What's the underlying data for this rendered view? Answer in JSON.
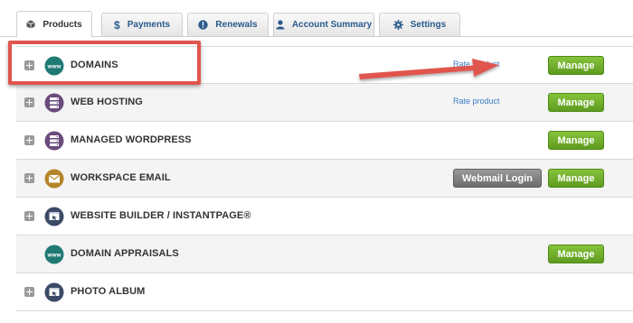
{
  "tabs": [
    {
      "label": "Products",
      "icon": "box-icon",
      "active": true
    },
    {
      "label": "Payments",
      "icon": "dollar-icon",
      "active": false
    },
    {
      "label": "Renewals",
      "icon": "alert-icon",
      "active": false
    },
    {
      "label": "Account Summary",
      "icon": "user-icon",
      "active": false
    },
    {
      "label": "Settings",
      "icon": "gear-icon",
      "active": false
    }
  ],
  "products": [
    {
      "name": "DOMAINS",
      "icon": "www-icon",
      "rate_link": "Rate product",
      "manage": "Manage"
    },
    {
      "name": "WEB HOSTING",
      "icon": "hosting-icon",
      "rate_link": "Rate product",
      "manage": "Manage"
    },
    {
      "name": "MANAGED WORDPRESS",
      "icon": "wordpress-icon",
      "manage": "Manage"
    },
    {
      "name": "WORKSPACE EMAIL",
      "icon": "email-icon",
      "webmail": "Webmail Login",
      "manage": "Manage"
    },
    {
      "name": "WEBSITE BUILDER / INSTANTPAGE®",
      "icon": "website-builder-icon"
    },
    {
      "name": "DOMAIN APPRAISALS",
      "icon": "www-icon",
      "manage": "Manage"
    },
    {
      "name": "PHOTO ALBUM",
      "icon": "photo-album-icon"
    }
  ],
  "colors": {
    "accent_green": "#6aa82a",
    "highlight_red": "#e0554d",
    "link_blue": "#3b7cc4",
    "www_teal": "#1f7a73",
    "hosting_purple": "#6a4b7c",
    "email_gold": "#b5842a",
    "builder_navy": "#3b4a66"
  }
}
